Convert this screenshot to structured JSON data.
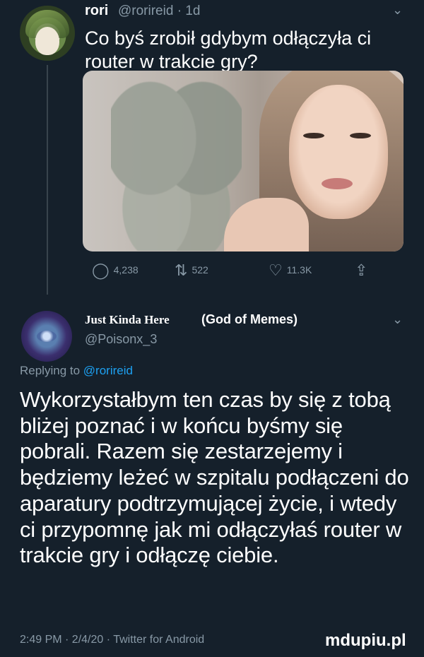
{
  "tweet1": {
    "name": "rori",
    "handle": "@rorireid · 1d",
    "text": "Co byś zrobił gdybym odłączyła ci router w trakcie gry?",
    "stats": {
      "replies": "4,238",
      "retweets": "522",
      "likes": "11.3K"
    }
  },
  "tweet2": {
    "name_serif": "Just Kinda Here",
    "name_rest": "(God of Memes)",
    "handle": "@Poisonx_3",
    "replying_prefix": "Replying to",
    "replying_mention": "@rorireid",
    "text": "Wykorzystałbym ten czas by się z tobą bliżej poznać i w końcu byśmy się pobrali. Razem się zestarzejemy i będziemy leżeć w szpitalu podłączeni do aparatury podtrzymującej życie, i wtedy ci przypomnę jak mi odłączyłaś router w trakcie gry i odłączę ciebie.",
    "footer": "2:49 PM · 2/4/20 · Twitter for Android"
  },
  "watermark": "mdupiu.pl",
  "icons": {
    "chevron": "chevron-down-icon",
    "reply": "reply-icon",
    "retweet": "retweet-icon",
    "like": "heart-icon",
    "share": "share-icon"
  },
  "colors": {
    "background": "#15202b",
    "secondary_text": "#8899a6",
    "link": "#1da1f2"
  }
}
